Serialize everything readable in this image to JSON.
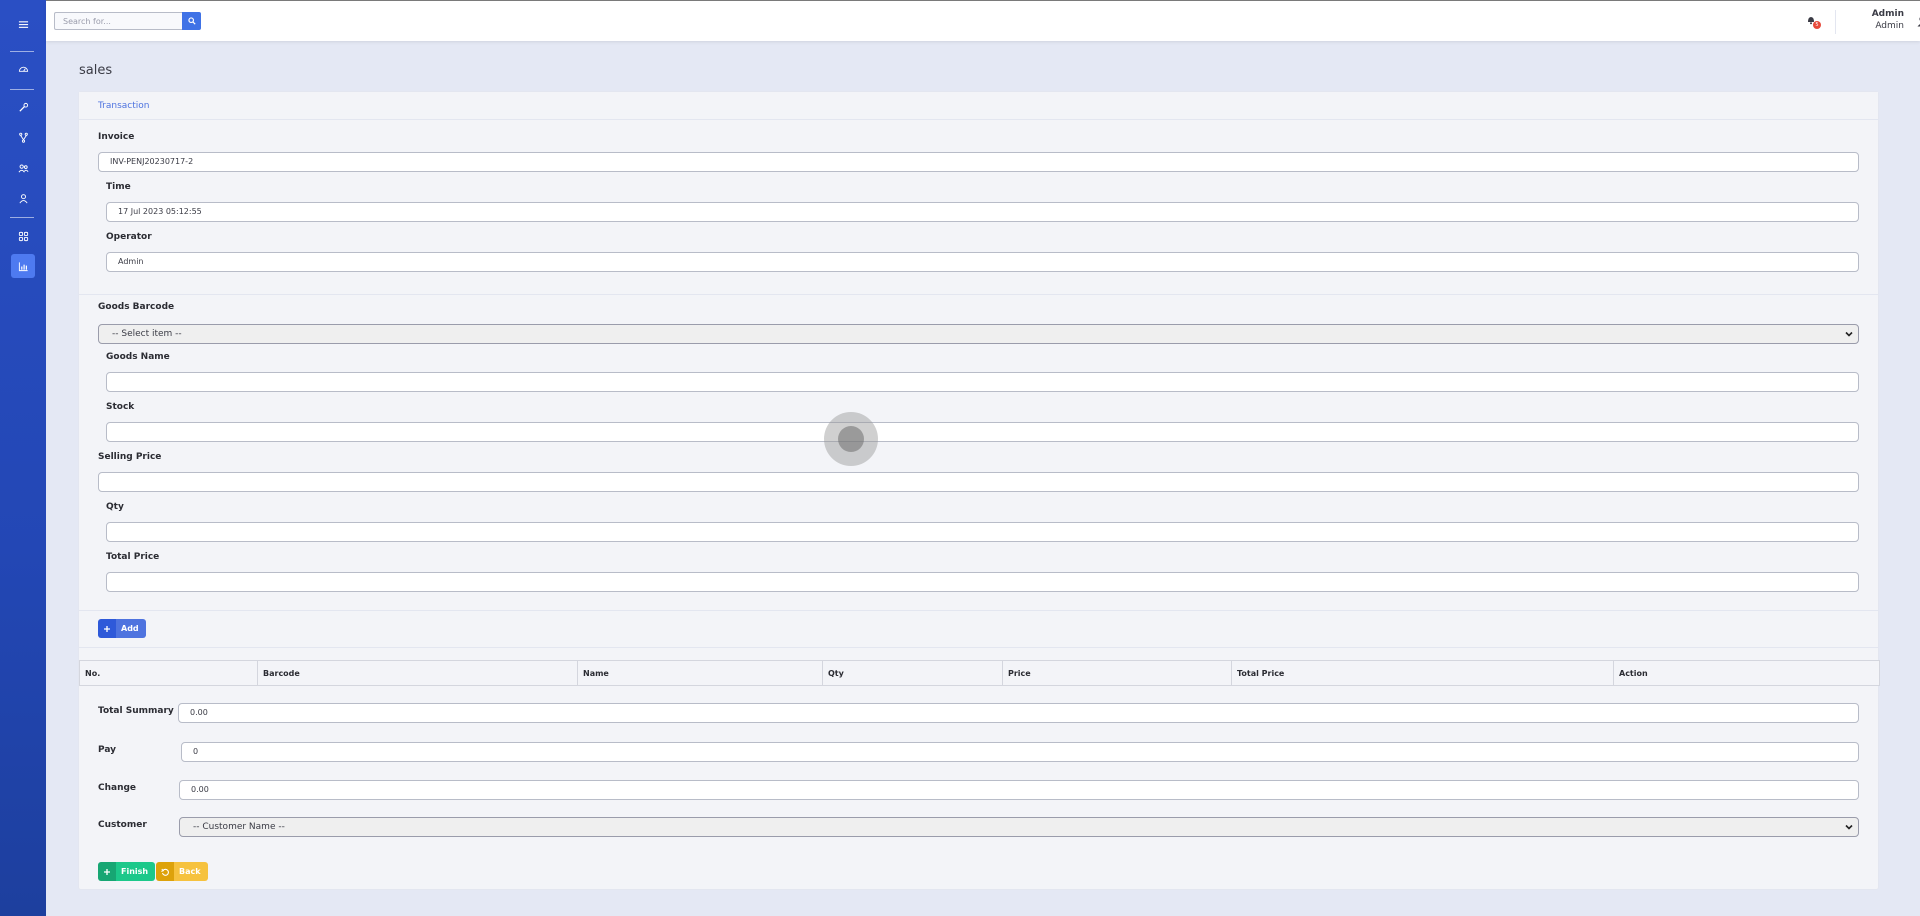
{
  "sidebar": {
    "items": [
      {
        "name": "menu-toggle-icon",
        "icon": "bars"
      },
      {
        "name": "dashboard-icon",
        "icon": "gauge"
      },
      {
        "name": "tools-icon",
        "icon": "wrench"
      },
      {
        "name": "fork-icon",
        "icon": "code-branch"
      },
      {
        "name": "users-icon",
        "icon": "users"
      },
      {
        "name": "user-icon",
        "icon": "user"
      },
      {
        "name": "grid-icon",
        "icon": "grid"
      },
      {
        "name": "chart-icon",
        "icon": "chart-bar",
        "active": true
      }
    ]
  },
  "topbar": {
    "search_placeholder": "Search for...",
    "notification_count": "5",
    "user_name": "Admin",
    "user_role": "Admin"
  },
  "page": {
    "title": "sales",
    "card_header": "Transaction"
  },
  "form": {
    "invoice_label": "Invoice",
    "invoice_value": "INV-PENJ20230717-2",
    "time_label": "Time",
    "time_value": "17 Jul 2023 05:12:55",
    "operator_label": "Operator",
    "operator_value": "Admin",
    "goods_barcode_label": "Goods Barcode",
    "goods_barcode_selected": "-- Select item --",
    "goods_name_label": "Goods Name",
    "goods_name_value": "",
    "stock_label": "Stock",
    "stock_value": "",
    "selling_price_label": "Selling Price",
    "selling_price_value": "",
    "qty_label": "Qty",
    "qty_value": "",
    "total_price_label": "Total Price",
    "total_price_value": "",
    "add_button": "Add"
  },
  "table": {
    "headers": [
      "No.",
      "Barcode",
      "Name",
      "Qty",
      "Price",
      "Total Price",
      "Action"
    ],
    "rows": []
  },
  "summary": {
    "total_summary_label": "Total Summary",
    "total_summary_value": "0.00",
    "pay_label": "Pay",
    "pay_value": "0",
    "change_label": "Change",
    "change_value": "0.00",
    "customer_label": "Customer",
    "customer_selected": "-- Customer Name --",
    "finish_button": "Finish",
    "back_button": "Back"
  },
  "colors": {
    "sidebar": "#2a4fc4",
    "primary": "#4e73df",
    "success": "#1cc88a",
    "warning": "#f6c23e",
    "danger": "#e74a3b"
  }
}
